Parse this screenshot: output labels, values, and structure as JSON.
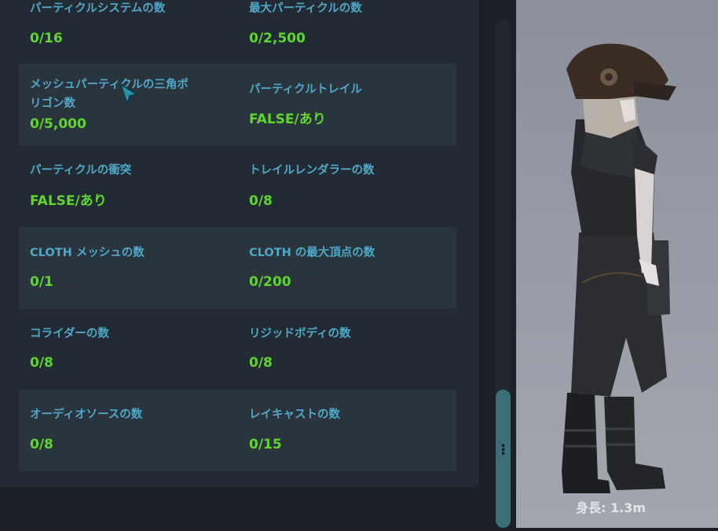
{
  "stats": [
    {
      "left": {
        "label": "パーティクルシステムの数",
        "value": "0/16"
      },
      "right": {
        "label": "最大パーティクルの数",
        "value": "0/2,500"
      }
    },
    {
      "left": {
        "label": "メッシュパーティクルの三角ポ\nリゴン数",
        "value": "0/5,000"
      },
      "right": {
        "label": "パーティクルトレイル",
        "value": "FALSE/あり"
      }
    },
    {
      "left": {
        "label": "パーティクルの衝突",
        "value": "FALSE/あり"
      },
      "right": {
        "label": "トレイルレンダラーの数",
        "value": "0/8"
      }
    },
    {
      "left": {
        "label": "CLOTH メッシュの数",
        "value": "0/1"
      },
      "right": {
        "label": "CLOTH の最大頂点の数",
        "value": "0/200"
      }
    },
    {
      "left": {
        "label": "コライダーの数",
        "value": "0/8"
      },
      "right": {
        "label": "リジッドボディの数",
        "value": "0/8"
      }
    },
    {
      "left": {
        "label": "オーディオソースの数",
        "value": "0/8"
      },
      "right": {
        "label": "レイキャストの数",
        "value": "0/15"
      }
    }
  ],
  "preview": {
    "height_label": "身長: 1.3m"
  },
  "colors": {
    "label": "#4fa8c8",
    "value": "#5fd62f",
    "accent": "#3a6f78"
  }
}
